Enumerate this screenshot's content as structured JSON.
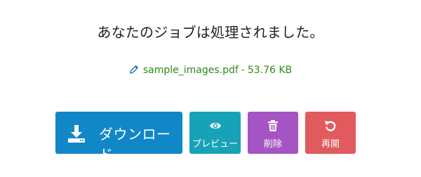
{
  "status": {
    "message": "あなたのジョブは処理されました。"
  },
  "file": {
    "name": "sample_images.pdf",
    "separator": "-",
    "size": "53.76 KB",
    "icon": "pencil-icon"
  },
  "actions": {
    "download": {
      "label": "ダウンロード",
      "icon": "download-icon",
      "color": "#1287c8"
    },
    "preview": {
      "label": "プレビュー",
      "icon": "eye-icon",
      "color": "#17a2b8"
    },
    "delete": {
      "label": "削除",
      "icon": "trash-icon",
      "color": "#a455c3"
    },
    "restart": {
      "label": "再開",
      "icon": "restart-icon",
      "color": "#e05a5e"
    }
  }
}
